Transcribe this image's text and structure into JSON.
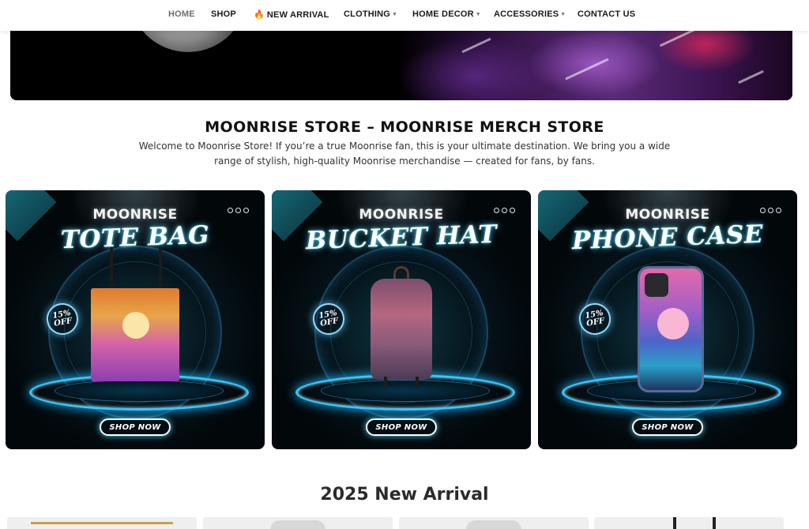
{
  "nav": {
    "items": [
      {
        "label": "HOME",
        "active": true
      },
      {
        "label": "SHOP"
      },
      {
        "label": "NEW ARRIVAL",
        "icon": "fire-icon"
      },
      {
        "label": "CLOTHING",
        "dropdown": true
      },
      {
        "label": "HOME DECOR",
        "dropdown": true
      },
      {
        "label": "ACCESSORIES",
        "dropdown": true
      },
      {
        "label": "CONTACT US"
      }
    ]
  },
  "intro": {
    "title": "MOONRISE STORE – MOONRISE MERCH STORE",
    "text": "Welcome to Moonrise Store! If you’re a true Moonrise fan, this is your ultimate destination. We bring you a wide range of stylish, high-quality Moonrise merchandise — created for fans, by fans."
  },
  "cards": [
    {
      "brand": "MOONRISE",
      "name": "TOTE BAG",
      "discount_pct": "15%",
      "discount_off": "OFF",
      "button": "SHOP NOW"
    },
    {
      "brand": "MOONRISE",
      "name": "BUCKET HAT",
      "discount_pct": "15%",
      "discount_off": "OFF",
      "button": "SHOP NOW"
    },
    {
      "brand": "MOONRISE",
      "name": "PHONE CASE",
      "discount_pct": "15%",
      "discount_off": "OFF",
      "button": "SHOP NOW"
    }
  ],
  "new_arrival": {
    "title": "2025 New Arrival"
  },
  "colors": {
    "accent_glow": "#34c9ff",
    "fire": "#f07b16",
    "nav_text": "#1a1a1a",
    "nav_active": "#6e6e6e"
  }
}
